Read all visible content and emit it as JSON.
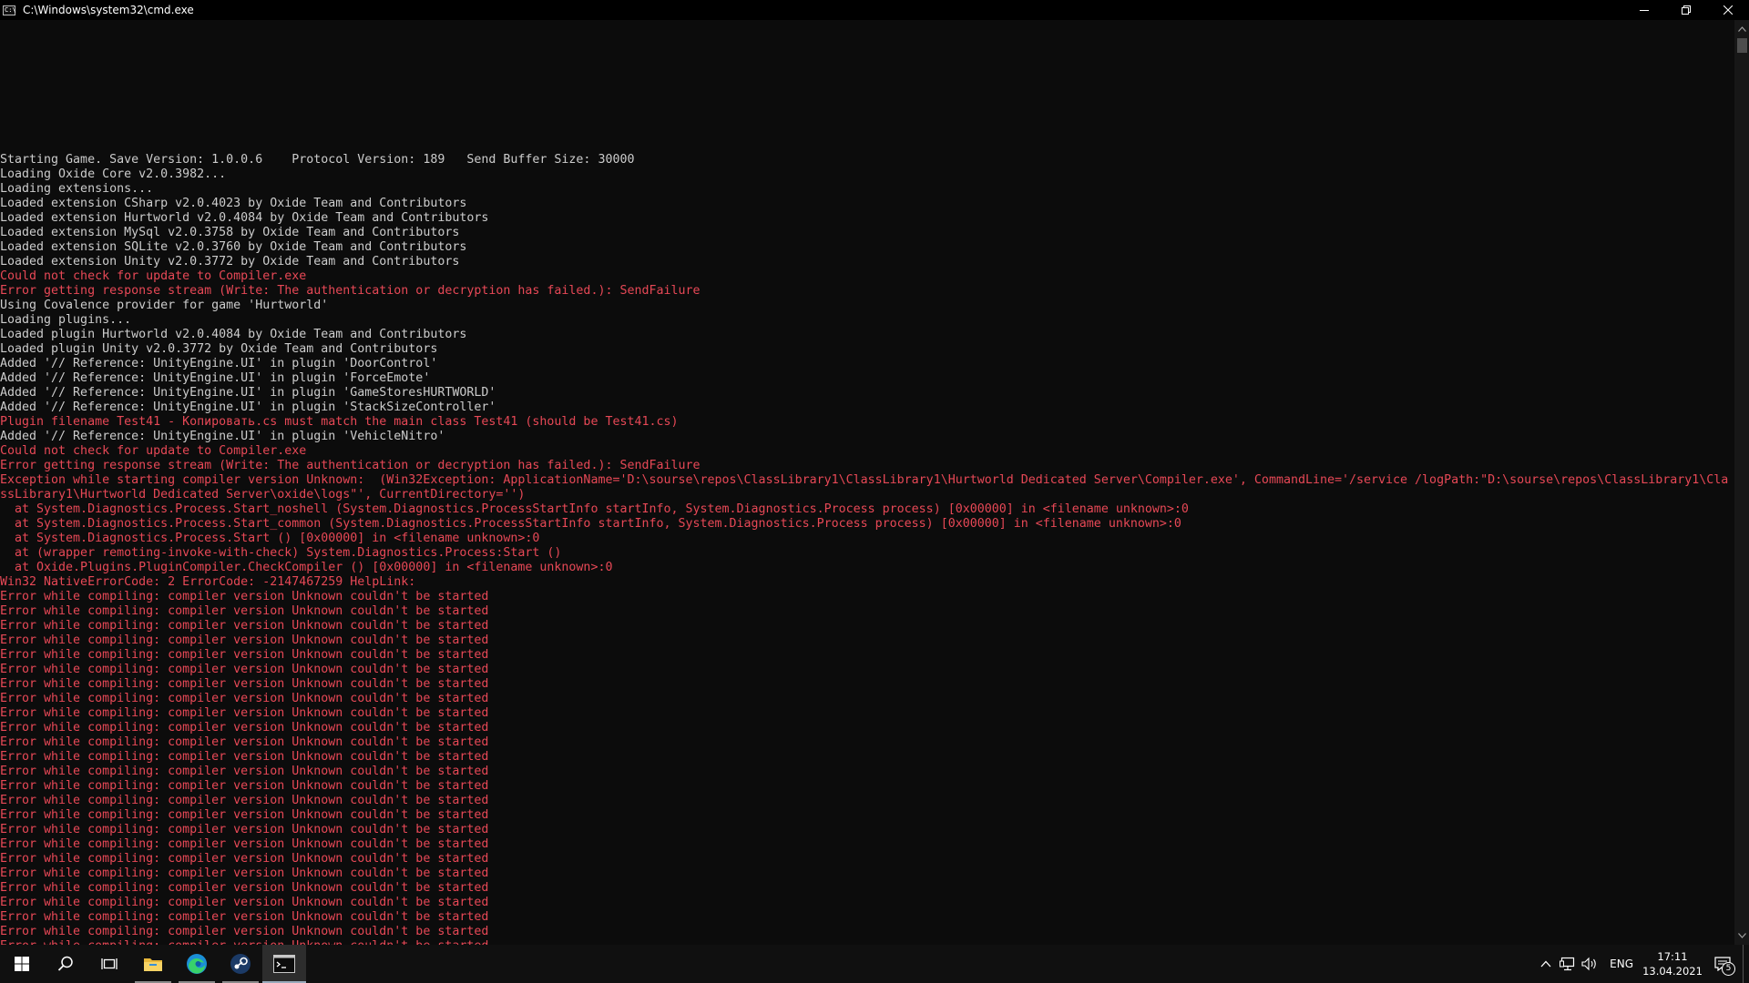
{
  "window": {
    "title": "C:\\Windows\\system32\\cmd.exe",
    "app_icon_text": "C:\\"
  },
  "colors": {
    "background": "#0c0c0c",
    "text": "#cccccc",
    "error": "#e74856"
  },
  "console": {
    "lines": [
      {
        "text": "Starting Game. Save Version: 1.0.0.6    Protocol Version: 189   Send Buffer Size: 30000",
        "type": "normal"
      },
      {
        "text": "Loading Oxide Core v2.0.3982...",
        "type": "normal"
      },
      {
        "text": "Loading extensions...",
        "type": "normal"
      },
      {
        "text": "Loaded extension CSharp v2.0.4023 by Oxide Team and Contributors",
        "type": "normal"
      },
      {
        "text": "Loaded extension Hurtworld v2.0.4084 by Oxide Team and Contributors",
        "type": "normal"
      },
      {
        "text": "Loaded extension MySql v2.0.3758 by Oxide Team and Contributors",
        "type": "normal"
      },
      {
        "text": "Loaded extension SQLite v2.0.3760 by Oxide Team and Contributors",
        "type": "normal"
      },
      {
        "text": "Loaded extension Unity v2.0.3772 by Oxide Team and Contributors",
        "type": "normal"
      },
      {
        "text": "Could not check for update to Compiler.exe",
        "type": "error"
      },
      {
        "text": "Error getting response stream (Write: The authentication or decryption has failed.): SendFailure",
        "type": "error"
      },
      {
        "text": "Using Covalence provider for game 'Hurtworld'",
        "type": "normal"
      },
      {
        "text": "Loading plugins...",
        "type": "normal"
      },
      {
        "text": "Loaded plugin Hurtworld v2.0.4084 by Oxide Team and Contributors",
        "type": "normal"
      },
      {
        "text": "Loaded plugin Unity v2.0.3772 by Oxide Team and Contributors",
        "type": "normal"
      },
      {
        "text": "Added '// Reference: UnityEngine.UI' in plugin 'DoorControl'",
        "type": "normal"
      },
      {
        "text": "Added '// Reference: UnityEngine.UI' in plugin 'ForceEmote'",
        "type": "normal"
      },
      {
        "text": "Added '// Reference: UnityEngine.UI' in plugin 'GameStoresHURTWORLD'",
        "type": "normal"
      },
      {
        "text": "Added '// Reference: UnityEngine.UI' in plugin 'StackSizeController'",
        "type": "normal"
      },
      {
        "text": "Plugin filename Test41 - Копировать.cs must match the main class Test41 (should be Test41.cs)",
        "type": "error"
      },
      {
        "text": "Added '// Reference: UnityEngine.UI' in plugin 'VehicleNitro'",
        "type": "normal"
      },
      {
        "text": "Could not check for update to Compiler.exe",
        "type": "error"
      },
      {
        "text": "Error getting response stream (Write: The authentication or decryption has failed.): SendFailure",
        "type": "error"
      },
      {
        "text": "Exception while starting compiler version Unknown:  (Win32Exception: ApplicationName='D:\\sourse\\repos\\ClassLibrary1\\ClassLibrary1\\Hurtworld Dedicated Server\\Compiler.exe', CommandLine='/service /logPath:\"D:\\sourse\\repos\\ClassLibrary1\\Cla",
        "type": "error"
      },
      {
        "text": "ssLibrary1\\Hurtworld Dedicated Server\\oxide\\logs\"', CurrentDirectory='')",
        "type": "error"
      },
      {
        "text": "  at System.Diagnostics.Process.Start_noshell (System.Diagnostics.ProcessStartInfo startInfo, System.Diagnostics.Process process) [0x00000] in <filename unknown>:0",
        "type": "error"
      },
      {
        "text": "  at System.Diagnostics.Process.Start_common (System.Diagnostics.ProcessStartInfo startInfo, System.Diagnostics.Process process) [0x00000] in <filename unknown>:0",
        "type": "error"
      },
      {
        "text": "  at System.Diagnostics.Process.Start () [0x00000] in <filename unknown>:0",
        "type": "error"
      },
      {
        "text": "  at (wrapper remoting-invoke-with-check) System.Diagnostics.Process:Start ()",
        "type": "error"
      },
      {
        "text": "  at Oxide.Plugins.PluginCompiler.CheckCompiler () [0x00000] in <filename unknown>:0",
        "type": "error"
      },
      {
        "text": "Win32 NativeErrorCode: 2 ErrorCode: -2147467259 HelpLink:",
        "type": "error"
      },
      {
        "text": "Error while compiling: compiler version Unknown couldn't be started",
        "type": "error"
      },
      {
        "text": "Error while compiling: compiler version Unknown couldn't be started",
        "type": "error"
      },
      {
        "text": "Error while compiling: compiler version Unknown couldn't be started",
        "type": "error"
      },
      {
        "text": "Error while compiling: compiler version Unknown couldn't be started",
        "type": "error"
      },
      {
        "text": "Error while compiling: compiler version Unknown couldn't be started",
        "type": "error"
      },
      {
        "text": "Error while compiling: compiler version Unknown couldn't be started",
        "type": "error"
      },
      {
        "text": "Error while compiling: compiler version Unknown couldn't be started",
        "type": "error"
      },
      {
        "text": "Error while compiling: compiler version Unknown couldn't be started",
        "type": "error"
      },
      {
        "text": "Error while compiling: compiler version Unknown couldn't be started",
        "type": "error"
      },
      {
        "text": "Error while compiling: compiler version Unknown couldn't be started",
        "type": "error"
      },
      {
        "text": "Error while compiling: compiler version Unknown couldn't be started",
        "type": "error"
      },
      {
        "text": "Error while compiling: compiler version Unknown couldn't be started",
        "type": "error"
      },
      {
        "text": "Error while compiling: compiler version Unknown couldn't be started",
        "type": "error"
      },
      {
        "text": "Error while compiling: compiler version Unknown couldn't be started",
        "type": "error"
      },
      {
        "text": "Error while compiling: compiler version Unknown couldn't be started",
        "type": "error"
      },
      {
        "text": "Error while compiling: compiler version Unknown couldn't be started",
        "type": "error"
      },
      {
        "text": "Error while compiling: compiler version Unknown couldn't be started",
        "type": "error"
      },
      {
        "text": "Error while compiling: compiler version Unknown couldn't be started",
        "type": "error"
      },
      {
        "text": "Error while compiling: compiler version Unknown couldn't be started",
        "type": "error"
      },
      {
        "text": "Error while compiling: compiler version Unknown couldn't be started",
        "type": "error"
      },
      {
        "text": "Error while compiling: compiler version Unknown couldn't be started",
        "type": "error"
      },
      {
        "text": "Error while compiling: compiler version Unknown couldn't be started",
        "type": "error"
      },
      {
        "text": "Error while compiling: compiler version Unknown couldn't be started",
        "type": "error"
      },
      {
        "text": "Error while compiling: compiler version Unknown couldn't be started",
        "type": "error"
      },
      {
        "text": "Error while compiling: compiler version Unknown couldn't be started",
        "type": "error"
      }
    ]
  },
  "taskbar": {
    "apps": [
      {
        "name": "start-button",
        "icon": "windows-logo-icon"
      },
      {
        "name": "search-button",
        "icon": "search-icon"
      },
      {
        "name": "task-view-button",
        "icon": "task-view-icon"
      },
      {
        "name": "file-explorer-button",
        "icon": "folder-icon"
      },
      {
        "name": "edge-button",
        "icon": "edge-icon"
      },
      {
        "name": "steam-button",
        "icon": "steam-icon"
      },
      {
        "name": "cmd-button",
        "icon": "cmd-icon"
      }
    ],
    "tray": {
      "language": "ENG",
      "time": "17:11",
      "date": "13.04.2021",
      "notification_count": "5"
    }
  }
}
